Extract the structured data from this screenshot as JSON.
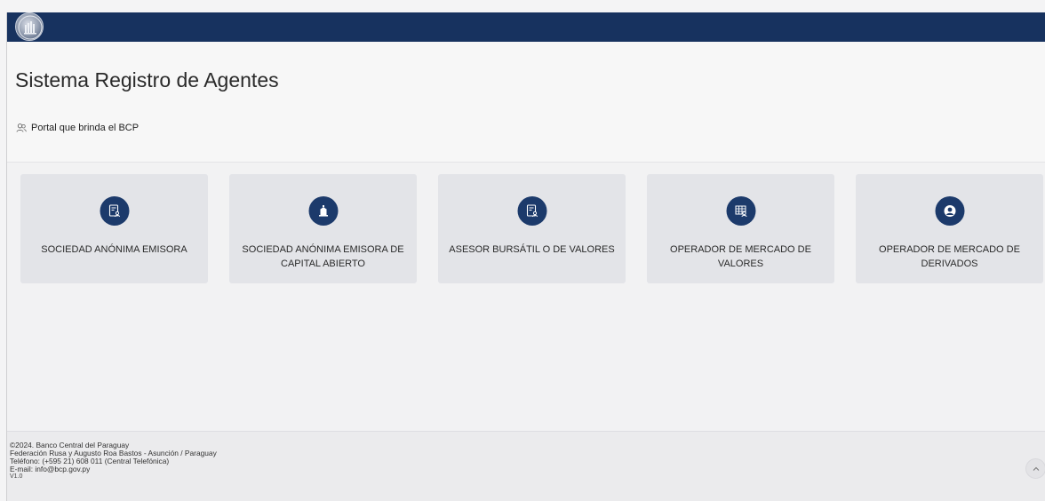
{
  "header": {
    "title": "Sistema Registro de Agentes",
    "subtitle": "Portal que brinda el BCP"
  },
  "cards": [
    {
      "label": "SOCIEDAD ANÓNIMA EMISORA",
      "icon": "document-person-icon"
    },
    {
      "label": "SOCIEDAD ANÓNIMA EMISORA DE CAPITAL ABIERTO",
      "icon": "building-icon"
    },
    {
      "label": "ASESOR BURSÁTIL O DE VALORES",
      "icon": "document-person-icon"
    },
    {
      "label": "OPERADOR DE MERCADO DE VALORES",
      "icon": "table-person-icon"
    },
    {
      "label": "OPERADOR DE MERCADO DE DERIVADOS",
      "icon": "user-circle-icon"
    }
  ],
  "footer": {
    "line1": "©2024. Banco Central del Paraguay",
    "line2": "Federación Rusa y Augusto Roa Bastos - Asunción / Paraguay",
    "line3": "Teléfono: (+595 21) 608 011 (Central Telefónica)",
    "line4": "E-mail: info@bcp.gov.py",
    "version": "V1.0"
  },
  "colors": {
    "topbar": "#17325f",
    "card_background": "#e3e4e8",
    "icon_circle": "#1c3a6b"
  }
}
